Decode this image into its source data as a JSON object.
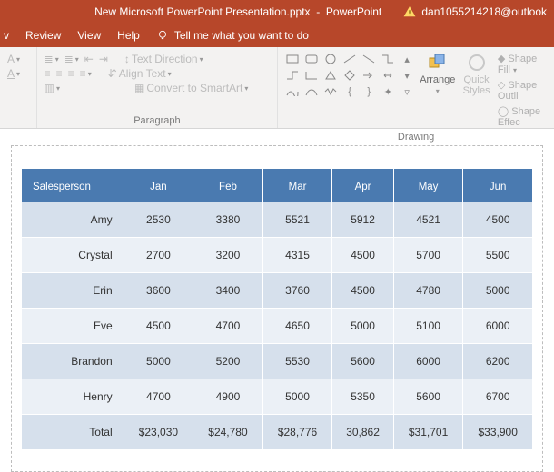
{
  "titlebar": {
    "filename": "New Microsoft PowerPoint Presentation.pptx",
    "appname": "PowerPoint",
    "account": "dan1055214218@outlook"
  },
  "menubar": {
    "cut_item": "v",
    "items": [
      "Review",
      "View",
      "Help"
    ],
    "tell_me": "Tell me what you want to do"
  },
  "ribbon": {
    "paragraph": {
      "label": "Paragraph",
      "text_direction": "Text Direction",
      "align_text": "Align Text",
      "convert_smartart": "Convert to SmartArt"
    },
    "drawing": {
      "label": "Drawing",
      "arrange": "Arrange",
      "quick_styles": "Quick\nStyles",
      "shape_fill": "Shape Fill",
      "shape_outline": "Shape Outli",
      "shape_effects": "Shape Effec"
    }
  },
  "chart_data": {
    "type": "table",
    "headers": [
      "Salesperson",
      "Jan",
      "Feb",
      "Mar",
      "Apr",
      "May",
      "Jun"
    ],
    "rows": [
      [
        "Amy",
        "2530",
        "3380",
        "5521",
        "5912",
        "4521",
        "4500"
      ],
      [
        "Crystal",
        "2700",
        "3200",
        "4315",
        "4500",
        "5700",
        "5500"
      ],
      [
        "Erin",
        "3600",
        "3400",
        "3760",
        "4500",
        "4780",
        "5000"
      ],
      [
        "Eve",
        "4500",
        "4700",
        "4650",
        "5000",
        "5100",
        "6000"
      ],
      [
        "Brandon",
        "5000",
        "5200",
        "5530",
        "5600",
        "6000",
        "6200"
      ],
      [
        "Henry",
        "4700",
        "4900",
        "5000",
        "5350",
        "5600",
        "6700"
      ],
      [
        "Total",
        "$23,030",
        "$24,780",
        "$28,776",
        "30,862",
        "$31,701",
        "$33,900"
      ]
    ]
  }
}
